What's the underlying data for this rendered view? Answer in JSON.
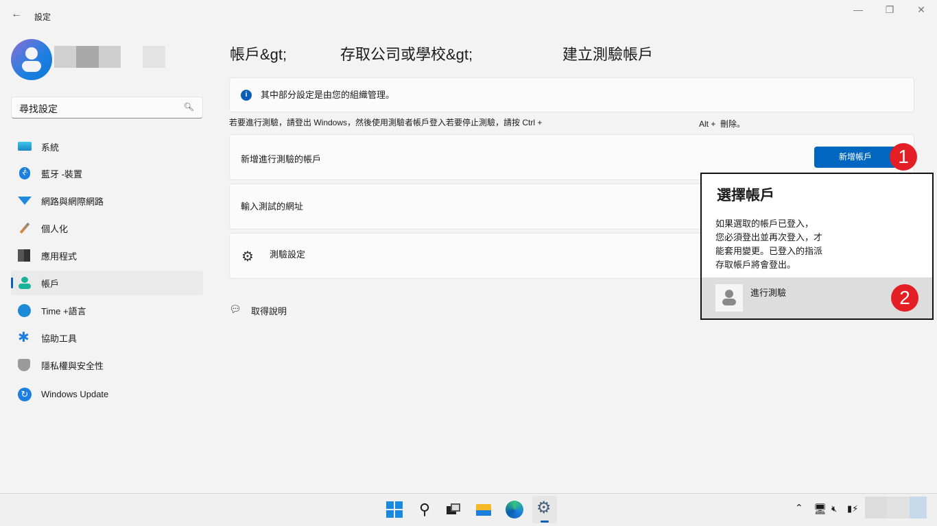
{
  "window": {
    "title": "設定",
    "back_icon": "arrow-left-icon",
    "controls": [
      "minimize",
      "maximize",
      "close"
    ]
  },
  "sidebar": {
    "search_placeholder": "尋找設定",
    "items": [
      {
        "label": "系統",
        "icon": "monitor-icon"
      },
      {
        "label": "藍牙 -裝置",
        "icon": "bluetooth-icon"
      },
      {
        "label": "網路與網際網路",
        "icon": "wifi-icon"
      },
      {
        "label": "個人化",
        "icon": "brush-icon"
      },
      {
        "label": "應用程式",
        "icon": "apps-icon"
      },
      {
        "label": "帳戶",
        "icon": "account-icon",
        "selected": true
      },
      {
        "label": "Time +語言",
        "icon": "time-language-icon"
      },
      {
        "label": "協助工具",
        "icon": "accessibility-icon"
      },
      {
        "label": "隱私權與安全性",
        "icon": "shield-icon"
      },
      {
        "label": "Windows Update",
        "icon": "update-icon"
      }
    ]
  },
  "breadcrumb": [
    "帳戶&gt;",
    "存取公司或學校&gt;",
    "建立測驗帳戶"
  ],
  "info": "其中部分設定是由您的組織管理。",
  "instructions": {
    "main": "若要進行測驗，請登出 Windows，然後使用測驗者帳戶登入若要停止測驗，請按 Ctrl +",
    "tail": "Alt +  刪除。"
  },
  "cards": {
    "add_account": "新增進行測驗的帳戶",
    "add_button": "新增帳戶",
    "enter_url": "輸入測試的網址",
    "test_settings": "測驗設定"
  },
  "help": "取得說明",
  "popup": {
    "title": "選擇帳戶",
    "lines": [
      "如果選取的帳戶已登入，",
      "您必須登出並再次登入，才",
      "能套用變更。已登入的指派",
      "存取帳戶將會登出。"
    ],
    "account": "進行測驗"
  },
  "badges": [
    "1",
    "2"
  ],
  "colors": {
    "accent": "#0067c0",
    "badge": "#e31e24"
  }
}
